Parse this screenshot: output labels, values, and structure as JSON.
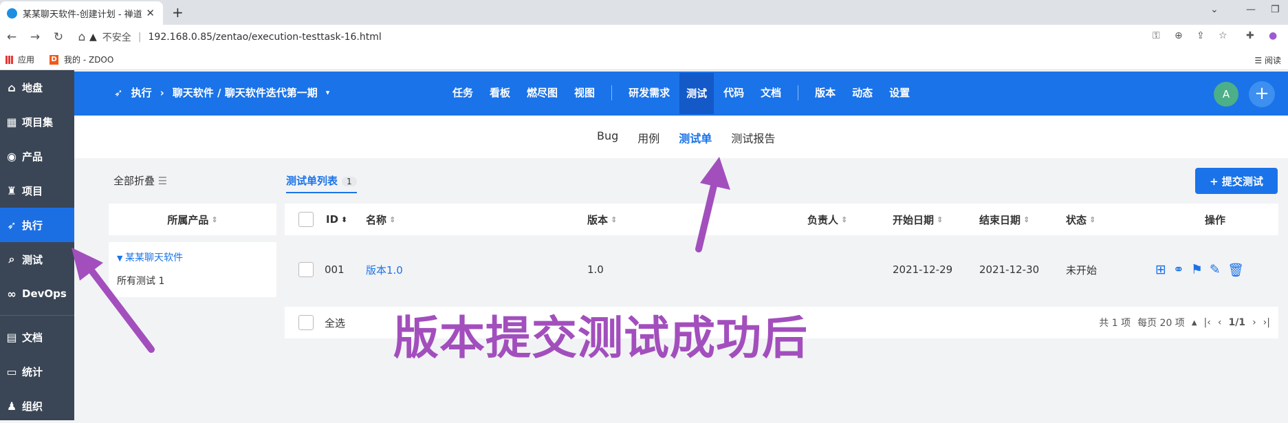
{
  "browser": {
    "tab_title": "某某聊天软件-创建计划 - 禅道",
    "new_tab": "+",
    "url_warning": "不安全",
    "url": "192.168.0.85/zentao/execution-testtask-16.html",
    "bookmarks": [
      "应用",
      "我的 - ZDOO"
    ],
    "reader": "阅读"
  },
  "sidebar": {
    "items": [
      {
        "label": "地盘",
        "icon": "home-icon"
      },
      {
        "label": "项目集",
        "icon": "grid-icon"
      },
      {
        "label": "产品",
        "icon": "location-icon"
      },
      {
        "label": "项目",
        "icon": "rocket-icon"
      },
      {
        "label": "执行",
        "icon": "run-icon",
        "active": true
      },
      {
        "label": "测试",
        "icon": "search-icon"
      },
      {
        "label": "DevOps",
        "icon": "infinity-icon"
      },
      {
        "label": "文档",
        "icon": "doc-icon"
      },
      {
        "label": "统计",
        "icon": "chart-icon"
      },
      {
        "label": "组织",
        "icon": "org-icon"
      }
    ]
  },
  "topbar": {
    "crumb_section": "执行",
    "crumb_path": "聊天软件 / 聊天软件迭代第一期",
    "nav": [
      "任务",
      "看板",
      "燃尽图",
      "视图",
      "研发需求",
      "测试",
      "代码",
      "文档",
      "版本",
      "动态",
      "设置"
    ],
    "active_nav": "测试",
    "avatar": "A"
  },
  "subnav": {
    "items": [
      "Bug",
      "用例",
      "测试单",
      "测试报告"
    ],
    "active": "测试单"
  },
  "left": {
    "collapse_all": "全部折叠",
    "product_header": "所属产品",
    "product_name": "某某聊天软件",
    "all_tests": "所有测试 1"
  },
  "main": {
    "list_tab": "测试单列表",
    "list_count": "1",
    "submit_button": "+ 提交测试",
    "columns": [
      "ID",
      "名称",
      "版本",
      "负责人",
      "开始日期",
      "结束日期",
      "状态",
      "操作"
    ],
    "rows": [
      {
        "id": "001",
        "name": "版本1.0",
        "build": "1.0",
        "owner": "",
        "begin": "2021-12-29",
        "end": "2021-12-30",
        "status": "未开始"
      }
    ],
    "select_all": "全选",
    "total": "共 1 项",
    "per_page": "每页 20 项",
    "page": "1/1"
  },
  "overlay_text": "版本提交测试成功后",
  "colors": {
    "primary": "#1a73e8",
    "sidebar": "#3a4656",
    "annotation": "#a24fbd"
  }
}
